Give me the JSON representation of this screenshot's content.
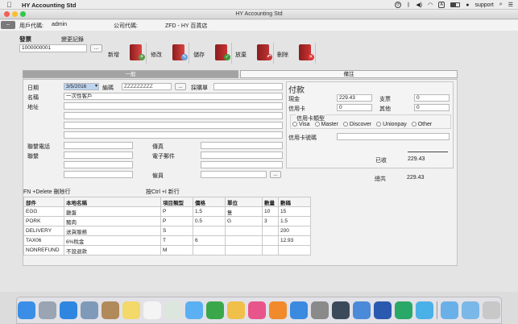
{
  "menubar": {
    "app_name": "HY Accounting Std",
    "user": "support",
    "tray_icons": [
      "sync-icon",
      "bluetooth-icon",
      "volume-icon",
      "wifi-icon",
      "keyboard-A-icon",
      "battery-icon",
      "user-icon",
      "search-icon",
      "list-icon"
    ],
    "input_letter": "A"
  },
  "window": {
    "title": "HY Accounting Std",
    "user_code_label": "用戶代碼:",
    "user_code": "admin",
    "company_code_label": "公司代碼:",
    "company_code": "ZFD - HY 百貨店"
  },
  "doc": {
    "invoice_label": "發票",
    "invoice_value": "1000000001",
    "history_label": "變更記錄",
    "browse_label": "..."
  },
  "toolbar": [
    {
      "label": "新增",
      "icon": "new-book-icon",
      "color": "#d44",
      "badge": "+",
      "badge_color": "#5a9a4a"
    },
    {
      "label": "修改",
      "icon": "edit-book-icon",
      "color": "#d44",
      "badge": "✎",
      "badge_color": "#6aa0d8"
    },
    {
      "label": "儲存",
      "icon": "save-book-icon",
      "color": "#c33",
      "badge": "✓",
      "badge_color": "#3a9a3a"
    },
    {
      "label": "放棄",
      "icon": "discard-book-icon",
      "color": "#b33",
      "badge": "↶",
      "badge_color": "#c33"
    },
    {
      "label": "刪除",
      "icon": "delete-book-icon",
      "color": "#c33",
      "badge": "✕",
      "badge_color": "#d33"
    }
  ],
  "tabs": [
    {
      "label": "一般",
      "active": true
    },
    {
      "label": "備註",
      "active": false
    }
  ],
  "form": {
    "date_label": "日期",
    "date_value": "3/5/2016",
    "code_label": "編碼",
    "code_value": "ZZZZZZZZZ",
    "code_browse": "...",
    "po_label": "採購單",
    "name_label": "名稱",
    "name_value": "一次性客戶",
    "address_label": "地址",
    "phone_label": "聯繫電話",
    "fax_label": "傳真",
    "contact_label": "聯繫",
    "email_label": "電子郵件",
    "staff_label": "僱員",
    "staff_browse": "..."
  },
  "payment": {
    "title": "付款",
    "cash_label": "現金",
    "cash_value": "229.43",
    "cheque_label": "支票",
    "cheque_value": "0",
    "card_label": "信用卡",
    "card_value": "0",
    "other_label": "其他",
    "other_value": "0",
    "card_type_label": "信用卡類型",
    "card_types": [
      "Visa",
      "Master",
      "Discover",
      "Unionpay",
      "Other"
    ],
    "card_no_label": "信用卡號碼",
    "received_label": "已收",
    "received_value": "229.43",
    "total_label": "總共",
    "total_value": "229.43"
  },
  "hints": {
    "delete_hint": "FN +Delete 刪除行",
    "new_hint": "按Ctrl +I 新行"
  },
  "grid": {
    "headers": [
      "部件",
      "本地名稱",
      "項目類型",
      "價格",
      "單位",
      "數量",
      "數碼"
    ],
    "rows": [
      [
        "EGG",
        "雞蛋",
        "P",
        "1.5",
        "隻",
        "10",
        "15"
      ],
      [
        "PORK",
        "豬肉",
        "P",
        "0.5",
        "G",
        "3",
        "1.5"
      ],
      [
        "DELIVERY",
        "送貨服務",
        "S",
        "",
        "",
        "",
        "200"
      ],
      [
        "TAX06",
        "6%稅金",
        "T",
        "6",
        "",
        "",
        "12.93"
      ],
      [
        "NONREFUND",
        "不設退款",
        "M",
        "",
        "",
        "",
        ""
      ]
    ]
  },
  "dock": {
    "apps": [
      {
        "name": "finder-icon",
        "color": "#3a8ee6"
      },
      {
        "name": "launchpad-icon",
        "color": "#9aa4b2"
      },
      {
        "name": "safari-icon",
        "color": "#2f86e0"
      },
      {
        "name": "preview-icon",
        "color": "#7f9ab8"
      },
      {
        "name": "contacts-icon",
        "color": "#b08a5a"
      },
      {
        "name": "notes-icon",
        "color": "#f3d86a"
      },
      {
        "name": "reminders-icon",
        "color": "#f4f4f4"
      },
      {
        "name": "photo-booth-icon",
        "color": "#dde6dc"
      },
      {
        "name": "messages-icon",
        "color": "#5ab0f2"
      },
      {
        "name": "facetime-icon",
        "color": "#3aa84a"
      },
      {
        "name": "photos-icon",
        "color": "#f0c04a"
      },
      {
        "name": "itunes-icon",
        "color": "#e8558a"
      },
      {
        "name": "ibooks-icon",
        "color": "#f08a2a"
      },
      {
        "name": "app-store-icon",
        "color": "#3a8ae0"
      },
      {
        "name": "system-preferences-icon",
        "color": "#8a8a8a"
      },
      {
        "name": "quicktime-icon",
        "color": "#3a4a5a"
      },
      {
        "name": "xcode-icon",
        "color": "#4a8ad8"
      },
      {
        "name": "word-icon",
        "color": "#2a5ab0"
      },
      {
        "name": "evernote-icon",
        "color": "#2aa868"
      },
      {
        "name": "bird-app-icon",
        "color": "#4ab0e8"
      },
      {
        "name": "folder-icon",
        "color": "#6ab0e8"
      },
      {
        "name": "downloads-icon",
        "color": "#7ab8e8"
      },
      {
        "name": "trash-icon",
        "color": "#c8c8c8"
      }
    ]
  }
}
